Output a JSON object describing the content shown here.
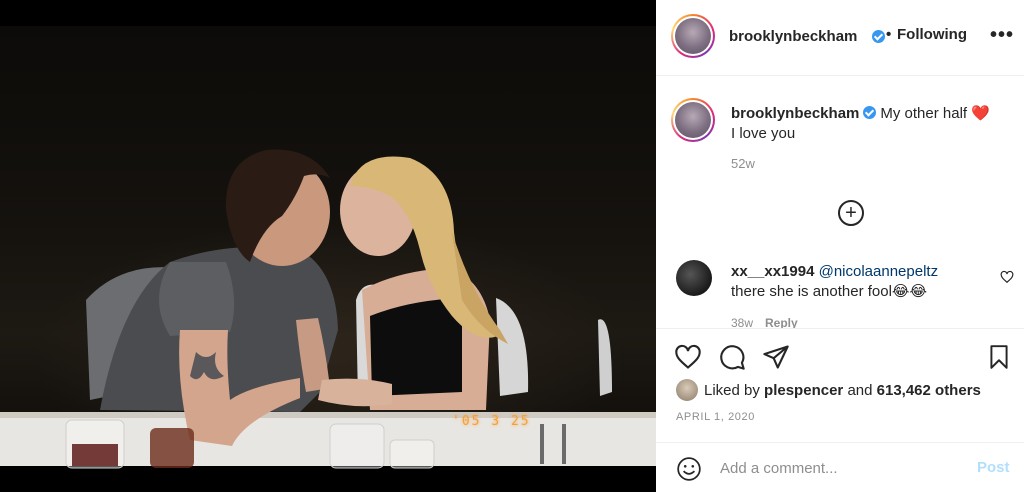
{
  "photo": {
    "date_stamp": "'05  3 25"
  },
  "header": {
    "username": "brooklynbeckham",
    "separator": "•",
    "follow_label": "Following",
    "more_label": "•••"
  },
  "caption": {
    "username": "brooklynbeckham",
    "text": "My other half",
    "emoji": "❤️",
    "line2": "I love you",
    "age": "52w"
  },
  "comment": {
    "username": "xx__xx1994",
    "mention": "@nicolaannepeltz",
    "text": "there she is another fool😂😂",
    "age": "38w",
    "reply_label": "Reply"
  },
  "likes": {
    "prefix": "Liked by",
    "user": "plespencer",
    "and": "and",
    "count": "613,462 others"
  },
  "post_date": "APRIL 1, 2020",
  "add_comment": {
    "placeholder": "Add a comment...",
    "post_label": "Post"
  },
  "icons": {
    "like": "heart-icon",
    "comment": "comment-icon",
    "share": "share-icon",
    "save": "bookmark-icon",
    "emoji": "smiley-icon",
    "expand": "plus-circle-icon"
  },
  "colors": {
    "verified": "#3897f0",
    "link": "#00376b",
    "post_disabled": "#b2dffc",
    "secondary_text": "#8e8e8e",
    "date_stamp": "#f2a23a"
  }
}
